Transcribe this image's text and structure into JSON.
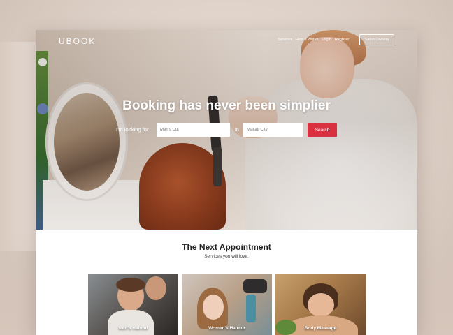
{
  "brand": {
    "logo": "UBOOK",
    "accent": "#d9313f"
  },
  "nav": {
    "items": [
      "Services",
      "How it Works",
      "Login",
      "Register"
    ],
    "cta": "Salon Owners"
  },
  "hero": {
    "headline": "Booking has never been simplier",
    "looking_label": "I'm looking for",
    "in_label": "in",
    "service_placeholder": "Men's Cut",
    "city_placeholder": "Makati City",
    "search_button": "Search"
  },
  "section": {
    "title": "The Next Appointment",
    "subtitle": "Services you will love."
  },
  "cards": [
    {
      "label": "Men's Haircut"
    },
    {
      "label": "Women's Haircut"
    },
    {
      "label": "Body Massage"
    }
  ]
}
